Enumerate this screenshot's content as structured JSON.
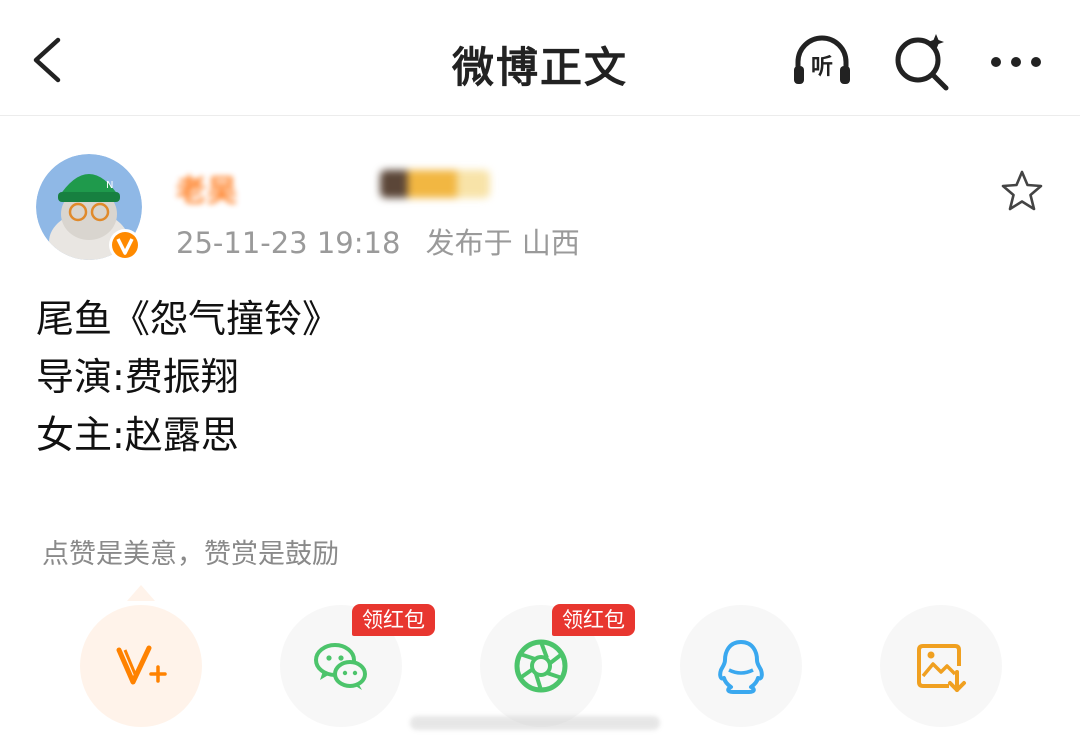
{
  "header": {
    "title": "微博正文",
    "listen_label": "听"
  },
  "post": {
    "author_name": "老吴",
    "timestamp": "25-11-23 19:18",
    "location_text": "发布于 山西",
    "lines": [
      "尾鱼《怨气撞铃》",
      "导演:费振翔",
      "女主:赵露思"
    ]
  },
  "reward_text": "点赞是美意，赞赏是鼓励",
  "share": {
    "tag_wechat": "领红包",
    "tag_moments": "领红包"
  },
  "colors": {
    "accent_orange": "#ff8200",
    "wechat_green": "#4cc46b",
    "qq_blue": "#3aa8ef",
    "tag_red": "#e8362f"
  }
}
